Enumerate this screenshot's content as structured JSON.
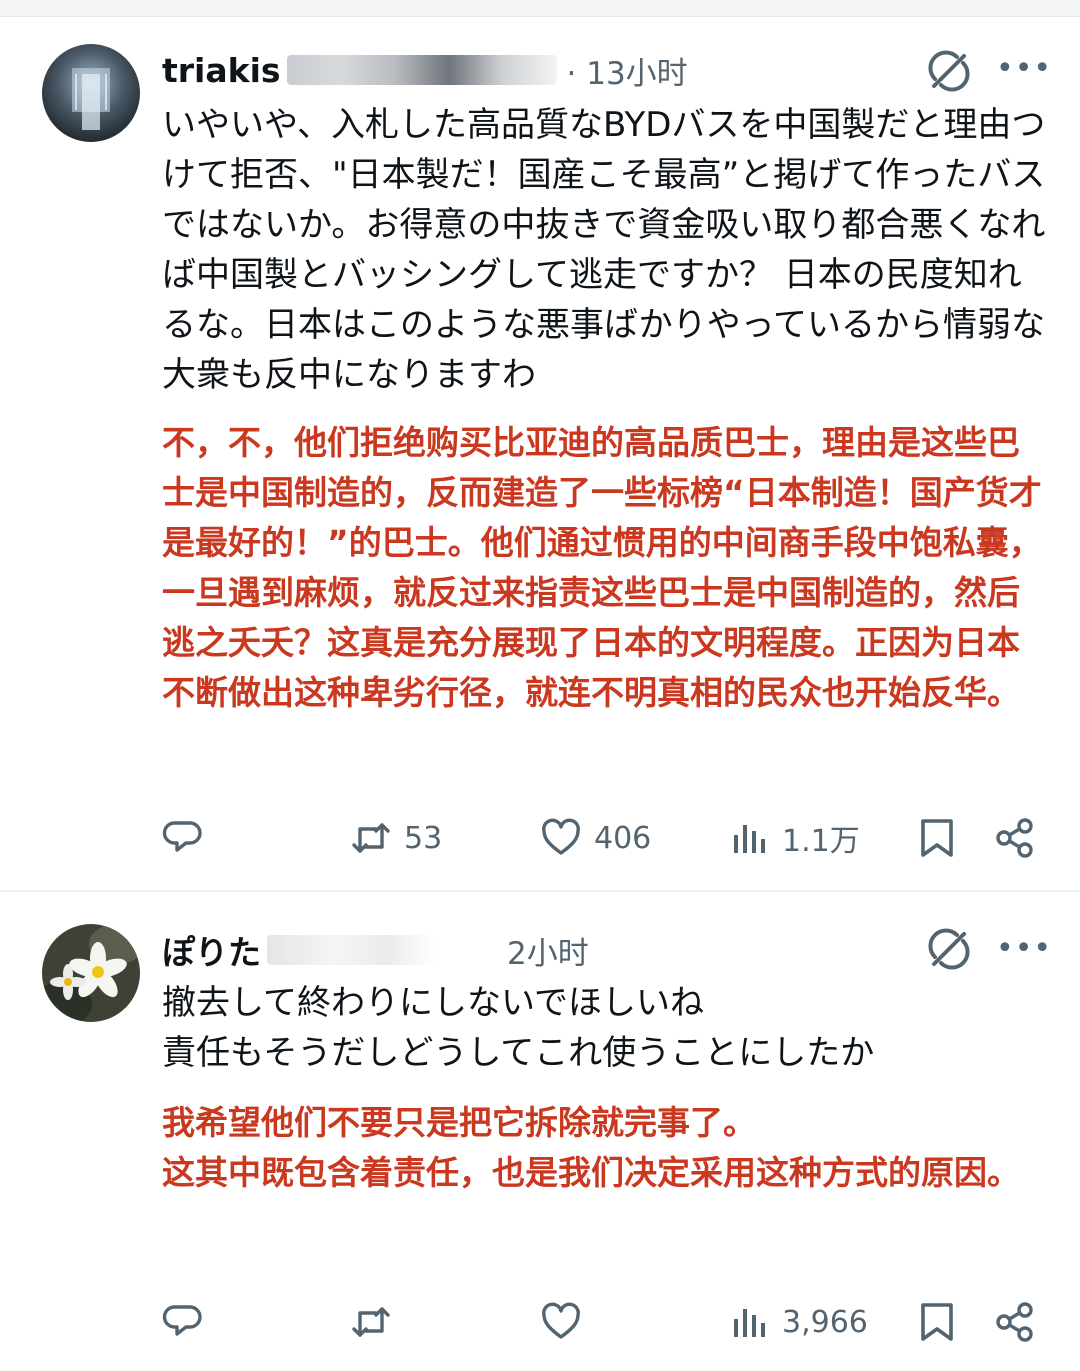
{
  "tweets": [
    {
      "author": "triakis",
      "time_prefix": "· 13小时",
      "text_jp": "いやいや、入札した高品質なBYDバスを中国製だと理由つけて拒否、\"日本製だ！国産こそ最高”と掲げて作ったバスではないか。お得意の中抜きで資金吸い取り都合悪くなれば中国製とバッシングして逃走ですか？ 日本の民度知れるな。日本はこのような悪事ばかりやっているから情弱な大衆も反中になりますわ",
      "text_cn": "不，不，他们拒绝购买比亚迪的高品质巴士，理由是这些巴士是中国制造的，反而建造了一些标榜“日本制造！国产货才是最好的！”的巴士。他们通过惯用的中间商手段中饱私囊，一旦遇到麻烦，就反过来指责这些巴士是中国制造的，然后逃之夭夭？这真是充分展现了日本的文明程度。正因为日本不断做出这种卑劣行径，就连不明真相的民众也开始反华。",
      "stats": {
        "retweets": "53",
        "likes": "406",
        "views": "1.1万"
      }
    },
    {
      "author": "ぽりた",
      "time_prefix": "2小时",
      "text_jp_lines": [
        "撤去して終わりにしないでほしいね",
        "責任もそうだしどうしてこれ使うことにしたか"
      ],
      "text_cn_lines": [
        "我希望他们不要只是把它拆除就完事了。",
        "这其中既包含着责任，也是我们决定采用这种方式的原因。"
      ],
      "stats": {
        "views": "3,966"
      }
    }
  ],
  "icons": [
    "reply-icon",
    "retweet-icon",
    "like-icon",
    "views-icon",
    "bookmark-icon",
    "share-icon",
    "grok-icon",
    "more-icon"
  ],
  "colors": {
    "text": "#0f1419",
    "muted": "#536471",
    "translation": "#c9381f"
  }
}
